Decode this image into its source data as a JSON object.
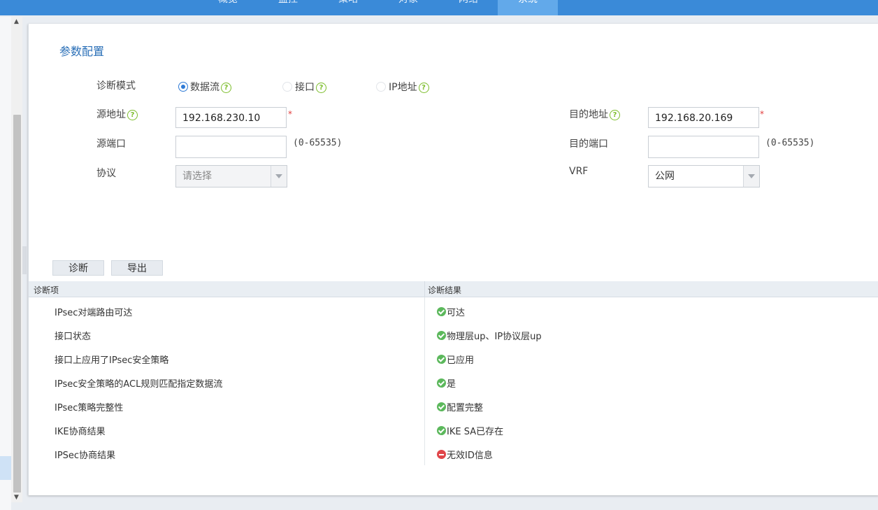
{
  "nav": {
    "tabs": [
      {
        "label": "概览"
      },
      {
        "label": "监控"
      },
      {
        "label": "策略"
      },
      {
        "label": "对象"
      },
      {
        "label": "网络"
      },
      {
        "label": "系统"
      }
    ]
  },
  "panel": {
    "title": "参数配置",
    "mode": {
      "label": "诊断模式",
      "options": [
        {
          "label": "数据流",
          "selected": true
        },
        {
          "label": "接口",
          "selected": false
        },
        {
          "label": "IP地址",
          "selected": false
        }
      ]
    },
    "src_addr": {
      "label": "源地址",
      "value": "192.168.230.10",
      "required": "*"
    },
    "dst_addr": {
      "label": "目的地址",
      "value": "192.168.20.169",
      "required": "*"
    },
    "src_port": {
      "label": "源端口",
      "value": "",
      "range": "(0-65535)"
    },
    "dst_port": {
      "label": "目的端口",
      "value": "",
      "range": "(0-65535)"
    },
    "protocol": {
      "label": "协议",
      "placeholder": "请选择"
    },
    "vrf": {
      "label": "VRF",
      "value": "公网"
    },
    "help_glyph": "?",
    "buttons": {
      "diagnose": "诊断",
      "export": "导出"
    }
  },
  "table": {
    "headers": {
      "item": "诊断项",
      "result": "诊断结果"
    },
    "rows": [
      {
        "item": "IPsec对端路由可达",
        "result": "可达",
        "status": "ok"
      },
      {
        "item": "接口状态",
        "result": "物理层up、IP协议层up",
        "status": "ok"
      },
      {
        "item": "接口上应用了IPsec安全策略",
        "result": "已应用",
        "status": "ok"
      },
      {
        "item": "IPsec安全策略的ACL规则匹配指定数据流",
        "result": "是",
        "status": "ok"
      },
      {
        "item": "IPsec策略完整性",
        "result": "配置完整",
        "status": "ok"
      },
      {
        "item": "IKE协商结果",
        "result": "IKE SA已存在",
        "status": "ok"
      },
      {
        "item": "IPSec协商结果",
        "result": "无效ID信息",
        "status": "error"
      }
    ]
  },
  "colors": {
    "nav": "#3a8ad8",
    "title": "#2a6fb7",
    "ok": "#5cb85c",
    "error": "#e0464a",
    "help": "#7cbd2b"
  }
}
